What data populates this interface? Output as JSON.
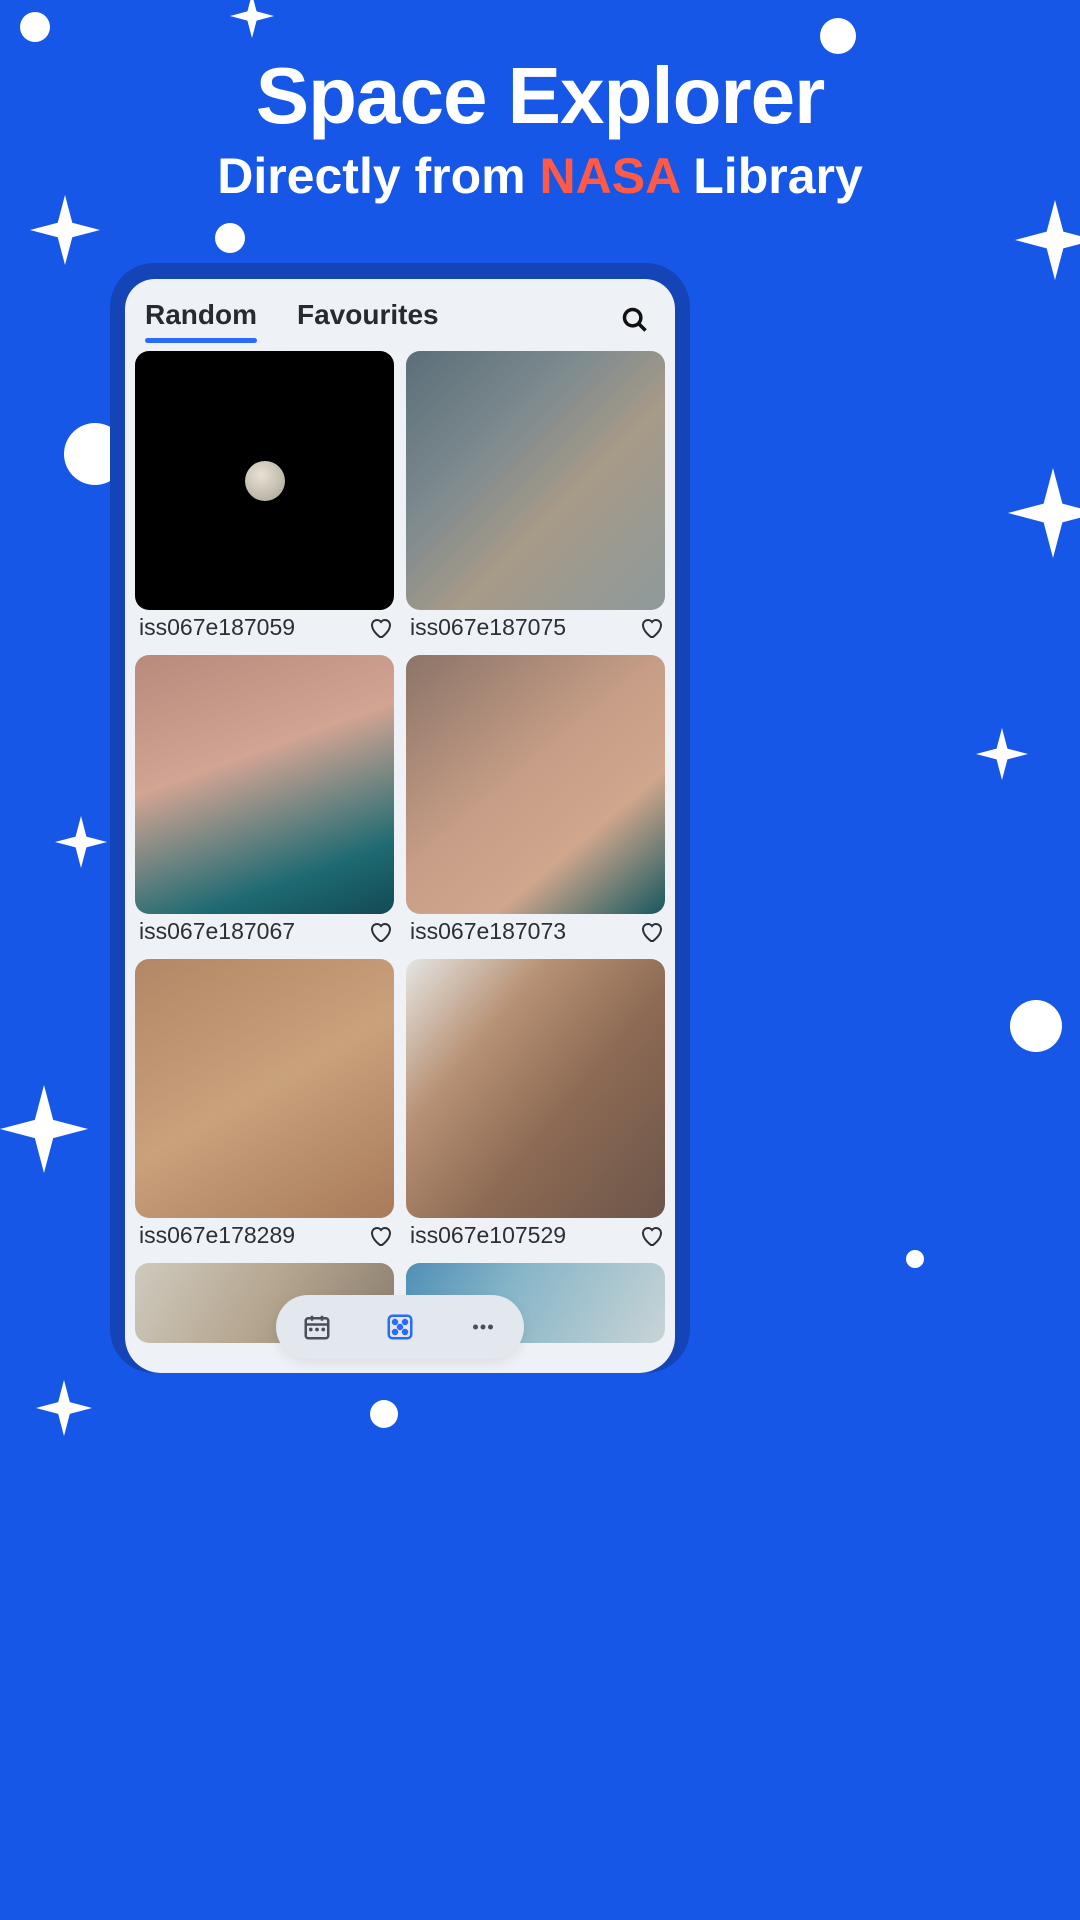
{
  "header": {
    "title": "Space Explorer",
    "subtitle_prefix": "Directly from ",
    "subtitle_accent": "NASA",
    "subtitle_suffix": " Library"
  },
  "tabs": [
    {
      "label": "Random",
      "active": true
    },
    {
      "label": "Favourites",
      "active": false
    }
  ],
  "icons": {
    "search": "search-icon"
  },
  "tiles": [
    {
      "label": "iss067e187059",
      "kind": "moon"
    },
    {
      "label": "iss067e187075",
      "kind": "earth-city"
    },
    {
      "label": "iss067e187067",
      "kind": "desert-coast"
    },
    {
      "label": "iss067e187073",
      "kind": "desert-coast2"
    },
    {
      "label": "iss067e178289",
      "kind": "desert-plain"
    },
    {
      "label": "iss067e107529",
      "kind": "terrain-lakes"
    }
  ],
  "nav": [
    {
      "name": "calendar",
      "active": false
    },
    {
      "name": "dice",
      "active": true
    },
    {
      "name": "more",
      "active": false
    }
  ],
  "colors": {
    "background": "#1757e8",
    "accent": "#ff5a47",
    "tab_active": "#2b6aff",
    "screen": "#eef1f5"
  }
}
